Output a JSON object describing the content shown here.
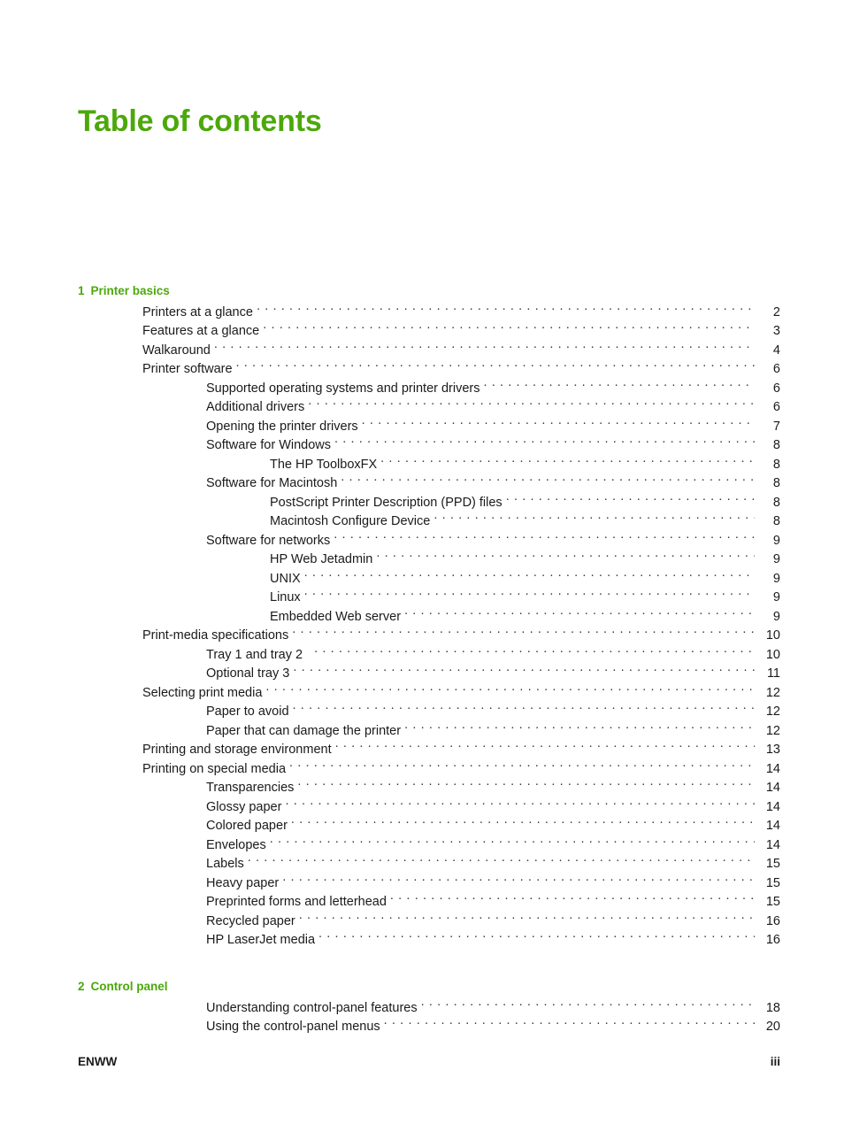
{
  "document": {
    "title": "Table of contents",
    "title_color": "#4CA80A"
  },
  "toc": {
    "chapters": [
      {
        "number": "1",
        "title": "Printer basics",
        "entries": [
          {
            "label": "Printers at a glance",
            "page": "2",
            "level": 1
          },
          {
            "label": "Features at a glance",
            "page": "3",
            "level": 1
          },
          {
            "label": "Walkaround",
            "page": "4",
            "level": 1
          },
          {
            "label": "Printer software",
            "page": "6",
            "level": 1
          },
          {
            "label": "Supported operating systems and printer drivers",
            "page": "6",
            "level": 2
          },
          {
            "label": "Additional drivers",
            "page": "6",
            "level": 2
          },
          {
            "label": "Opening the printer drivers",
            "page": "7",
            "level": 2
          },
          {
            "label": "Software for Windows",
            "page": "8",
            "level": 2
          },
          {
            "label": "The HP ToolboxFX",
            "page": "8",
            "level": 3
          },
          {
            "label": "Software for Macintosh",
            "page": "8",
            "level": 2
          },
          {
            "label": "PostScript Printer Description (PPD) files",
            "page": "8",
            "level": 3
          },
          {
            "label": "Macintosh Configure Device",
            "page": "8",
            "level": 3
          },
          {
            "label": "Software for networks",
            "page": "9",
            "level": 2
          },
          {
            "label": "HP Web Jetadmin",
            "page": "9",
            "level": 3
          },
          {
            "label": "UNIX",
            "page": "9",
            "level": 3
          },
          {
            "label": "Linux",
            "page": "9",
            "level": 3
          },
          {
            "label": "Embedded Web server",
            "page": "9",
            "level": 3
          },
          {
            "label": "Print-media specifications",
            "page": "10",
            "level": 1
          },
          {
            "label": "Tray 1 and tray 2",
            "page": "10",
            "level": 2,
            "wide_gap": true
          },
          {
            "label": "Optional tray 3",
            "page": "11",
            "level": 2
          },
          {
            "label": "Selecting print media",
            "page": "12",
            "level": 1
          },
          {
            "label": "Paper to avoid",
            "page": "12",
            "level": 2
          },
          {
            "label": "Paper that can damage the printer",
            "page": "12",
            "level": 2
          },
          {
            "label": "Printing and storage environment",
            "page": "13",
            "level": 1
          },
          {
            "label": "Printing on special media",
            "page": "14",
            "level": 1
          },
          {
            "label": "Transparencies",
            "page": "14",
            "level": 2
          },
          {
            "label": "Glossy paper",
            "page": "14",
            "level": 2
          },
          {
            "label": "Colored paper",
            "page": "14",
            "level": 2
          },
          {
            "label": "Envelopes",
            "page": "14",
            "level": 2
          },
          {
            "label": "Labels",
            "page": "15",
            "level": 2
          },
          {
            "label": "Heavy paper",
            "page": "15",
            "level": 2
          },
          {
            "label": "Preprinted forms and letterhead",
            "page": "15",
            "level": 2
          },
          {
            "label": "Recycled paper",
            "page": "16",
            "level": 2
          },
          {
            "label": "HP LaserJet media",
            "page": "16",
            "level": 2
          }
        ]
      },
      {
        "number": "2",
        "title": "Control panel",
        "entries": [
          {
            "label": "Understanding control-panel features",
            "page": "18",
            "level": 2
          },
          {
            "label": "Using the control-panel menus",
            "page": "20",
            "level": 2
          }
        ]
      }
    ]
  },
  "footer": {
    "left": "ENWW",
    "right": "iii"
  }
}
